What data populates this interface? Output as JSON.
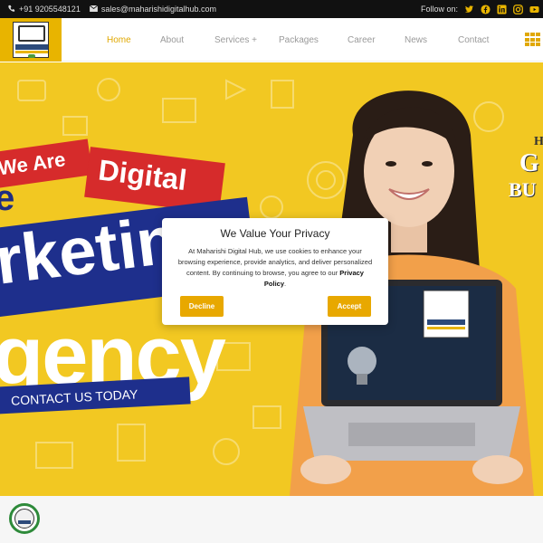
{
  "topbar": {
    "phone": "+91 9205548121",
    "email": "sales@maharishidigitalhub.com",
    "follow_label": "Follow on:",
    "social_icons": [
      "twitter-icon",
      "facebook-icon",
      "linkedin-icon",
      "instagram-icon",
      "youtube-icon"
    ]
  },
  "nav": {
    "items": [
      {
        "label": "Home",
        "active": true
      },
      {
        "label": "About"
      },
      {
        "label": "Services +"
      },
      {
        "label": "Packages"
      },
      {
        "label": "Career"
      },
      {
        "label": "News"
      },
      {
        "label": "Contact"
      }
    ]
  },
  "hero": {
    "we_are": "We Are",
    "digital": "Digital",
    "e_char": "e",
    "marketing": "rketin",
    "agency": "gency",
    "contact_cta": "CONTACT US TODAY",
    "right_h": "H",
    "right_g": "G",
    "right_bu": "BU"
  },
  "cookie_modal": {
    "title": "We Value Your Privacy",
    "body": "At Maharishi Digital Hub, we use cookies to enhance your browsing experience, provide analytics, and deliver personalized content. By continuing to browse, you agree to our",
    "policy_link": "Privacy Policy",
    "period": ".",
    "decline": "Decline",
    "accept": "Accept"
  },
  "colors": {
    "accent": "#e8a800",
    "hero_bg": "#f2c822",
    "banner_red": "#d62b2b",
    "banner_blue": "#1e2f8c"
  }
}
